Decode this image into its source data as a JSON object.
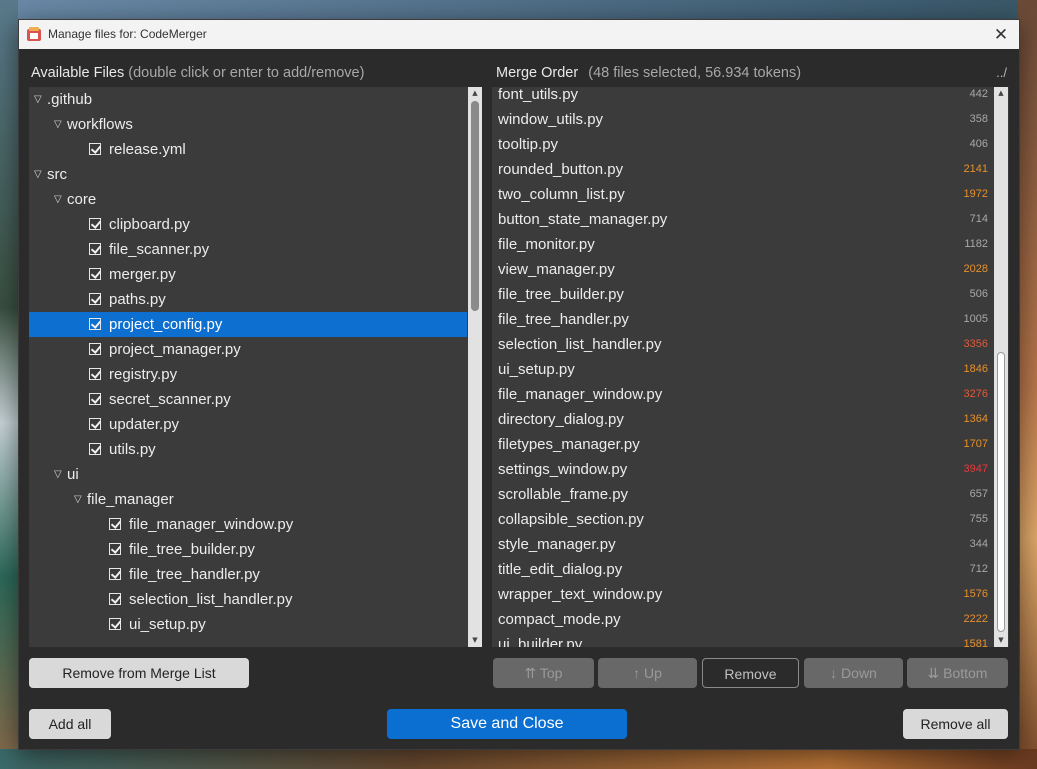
{
  "window": {
    "title": "Manage files for: CodeMerger",
    "close_glyph": "✕"
  },
  "available": {
    "header": "Available Files",
    "hint": "(double click or enter to add/remove)",
    "tree": [
      {
        "label": ".github",
        "type": "folder",
        "depth": 0
      },
      {
        "label": "workflows",
        "type": "folder",
        "depth": 1
      },
      {
        "label": "release.yml",
        "type": "file",
        "depth": 2
      },
      {
        "label": "src",
        "type": "folder",
        "depth": 0
      },
      {
        "label": "core",
        "type": "folder",
        "depth": 1
      },
      {
        "label": "clipboard.py",
        "type": "file",
        "depth": 2
      },
      {
        "label": "file_scanner.py",
        "type": "file",
        "depth": 2
      },
      {
        "label": "merger.py",
        "type": "file",
        "depth": 2
      },
      {
        "label": "paths.py",
        "type": "file",
        "depth": 2
      },
      {
        "label": "project_config.py",
        "type": "file",
        "depth": 2,
        "selected": true
      },
      {
        "label": "project_manager.py",
        "type": "file",
        "depth": 2
      },
      {
        "label": "registry.py",
        "type": "file",
        "depth": 2
      },
      {
        "label": "secret_scanner.py",
        "type": "file",
        "depth": 2
      },
      {
        "label": "updater.py",
        "type": "file",
        "depth": 2
      },
      {
        "label": "utils.py",
        "type": "file",
        "depth": 2
      },
      {
        "label": "ui",
        "type": "folder",
        "depth": 1
      },
      {
        "label": "file_manager",
        "type": "folder",
        "depth": 2
      },
      {
        "label": "file_manager_window.py",
        "type": "file",
        "depth": 3
      },
      {
        "label": "file_tree_builder.py",
        "type": "file",
        "depth": 3
      },
      {
        "label": "file_tree_handler.py",
        "type": "file",
        "depth": 3
      },
      {
        "label": "selection_list_handler.py",
        "type": "file",
        "depth": 3
      },
      {
        "label": "ui_setup.py",
        "type": "file",
        "depth": 3
      }
    ]
  },
  "merge": {
    "header": "Merge Order",
    "summary": "(48 files selected, 56.934 tokens)",
    "up_dir": "../",
    "files": [
      {
        "name": "font_utils.py",
        "tokens": "442",
        "color": "#a8a8a8"
      },
      {
        "name": "window_utils.py",
        "tokens": "358",
        "color": "#a8a8a8"
      },
      {
        "name": "tooltip.py",
        "tokens": "406",
        "color": "#a8a8a8"
      },
      {
        "name": "rounded_button.py",
        "tokens": "2141",
        "color": "#e8902a"
      },
      {
        "name": "two_column_list.py",
        "tokens": "1972",
        "color": "#e8902a"
      },
      {
        "name": "button_state_manager.py",
        "tokens": "714",
        "color": "#a8a8a8"
      },
      {
        "name": "file_monitor.py",
        "tokens": "1182",
        "color": "#a8a8a8"
      },
      {
        "name": "view_manager.py",
        "tokens": "2028",
        "color": "#e8902a"
      },
      {
        "name": "file_tree_builder.py",
        "tokens": "506",
        "color": "#a8a8a8"
      },
      {
        "name": "file_tree_handler.py",
        "tokens": "1005",
        "color": "#a8a8a8"
      },
      {
        "name": "selection_list_handler.py",
        "tokens": "3356",
        "color": "#e05a3a"
      },
      {
        "name": "ui_setup.py",
        "tokens": "1846",
        "color": "#e8902a"
      },
      {
        "name": "file_manager_window.py",
        "tokens": "3276",
        "color": "#e05a3a"
      },
      {
        "name": "directory_dialog.py",
        "tokens": "1364",
        "color": "#e8902a"
      },
      {
        "name": "filetypes_manager.py",
        "tokens": "1707",
        "color": "#e8902a"
      },
      {
        "name": "settings_window.py",
        "tokens": "3947",
        "color": "#e83a3a"
      },
      {
        "name": "scrollable_frame.py",
        "tokens": "657",
        "color": "#a8a8a8"
      },
      {
        "name": "collapsible_section.py",
        "tokens": "755",
        "color": "#a8a8a8"
      },
      {
        "name": "style_manager.py",
        "tokens": "344",
        "color": "#a8a8a8"
      },
      {
        "name": "title_edit_dialog.py",
        "tokens": "712",
        "color": "#a8a8a8"
      },
      {
        "name": "wrapper_text_window.py",
        "tokens": "1576",
        "color": "#e8902a"
      },
      {
        "name": "compact_mode.py",
        "tokens": "2222",
        "color": "#e8902a"
      },
      {
        "name": "ui_builder.py",
        "tokens": "1581",
        "color": "#e8902a"
      }
    ]
  },
  "buttons": {
    "remove_from_merge": "Remove from Merge List",
    "top": "⇈ Top",
    "up": "↑ Up",
    "remove": "Remove",
    "down": "↓ Down",
    "bottom": "⇊ Bottom",
    "add_all": "Add all",
    "save_close": "Save and Close",
    "remove_all": "Remove all"
  }
}
